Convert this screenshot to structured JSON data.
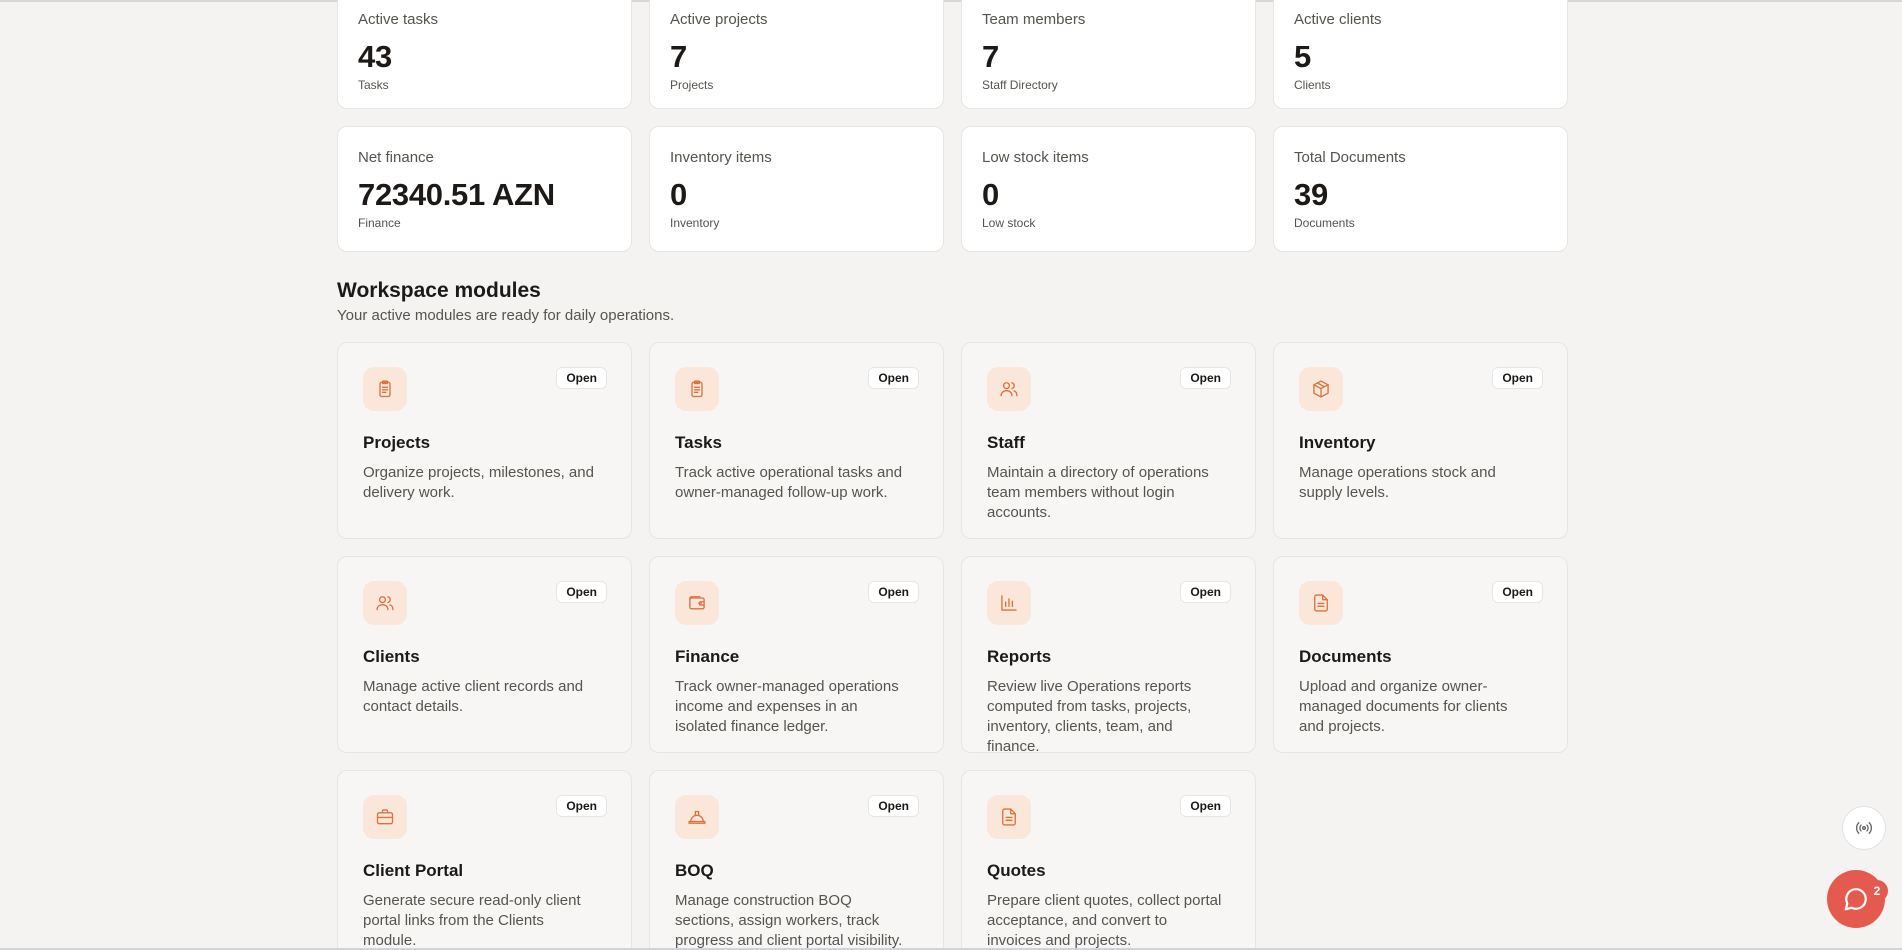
{
  "stats": [
    {
      "label": "Active tasks",
      "value": "43",
      "sub": "Tasks"
    },
    {
      "label": "Active projects",
      "value": "7",
      "sub": "Projects"
    },
    {
      "label": "Team members",
      "value": "7",
      "sub": "Staff Directory"
    },
    {
      "label": "Active clients",
      "value": "5",
      "sub": "Clients"
    },
    {
      "label": "Net finance",
      "value": "72340.51 AZN",
      "sub": "Finance"
    },
    {
      "label": "Inventory items",
      "value": "0",
      "sub": "Inventory"
    },
    {
      "label": "Low stock items",
      "value": "0",
      "sub": "Low stock"
    },
    {
      "label": "Total Documents",
      "value": "39",
      "sub": "Documents"
    }
  ],
  "modules_section": {
    "title": "Workspace modules",
    "subtitle": "Your active modules are ready for daily operations."
  },
  "modules": [
    {
      "name": "Projects",
      "icon": "clipboard-icon",
      "open_label": "Open",
      "desc": "Organize projects, milestones, and delivery work."
    },
    {
      "name": "Tasks",
      "icon": "clipboard-icon",
      "open_label": "Open",
      "desc": "Track active operational tasks and owner-managed follow-up work."
    },
    {
      "name": "Staff",
      "icon": "users-icon",
      "open_label": "Open",
      "desc": "Maintain a directory of operations team members without login accounts."
    },
    {
      "name": "Inventory",
      "icon": "box-icon",
      "open_label": "Open",
      "desc": "Manage operations stock and supply levels."
    },
    {
      "name": "Clients",
      "icon": "users-icon",
      "open_label": "Open",
      "desc": "Manage active client records and contact details."
    },
    {
      "name": "Finance",
      "icon": "wallet-icon",
      "open_label": "Open",
      "desc": "Track owner-managed operations income and expenses in an isolated finance ledger."
    },
    {
      "name": "Reports",
      "icon": "bar-chart-icon",
      "open_label": "Open",
      "desc": "Review live Operations reports computed from tasks, projects, inventory, clients, team, and finance."
    },
    {
      "name": "Documents",
      "icon": "file-icon",
      "open_label": "Open",
      "desc": "Upload and organize owner-managed documents for clients and projects."
    },
    {
      "name": "Client Portal",
      "icon": "briefcase-icon",
      "open_label": "Open",
      "desc": "Generate secure read-only client portal links from the Clients module."
    },
    {
      "name": "BOQ",
      "icon": "hard-hat-icon",
      "open_label": "Open",
      "desc": "Manage construction BOQ sections, assign workers, track progress and client portal visibility."
    },
    {
      "name": "Quotes",
      "icon": "file-icon",
      "open_label": "Open",
      "desc": "Prepare client quotes, collect portal acceptance, and convert to invoices and projects."
    }
  ],
  "chat": {
    "badge_count": "2"
  },
  "colors": {
    "accent": "#d97340",
    "icon_bg": "#fbe7da",
    "chat_fab": "#e55a4f"
  }
}
